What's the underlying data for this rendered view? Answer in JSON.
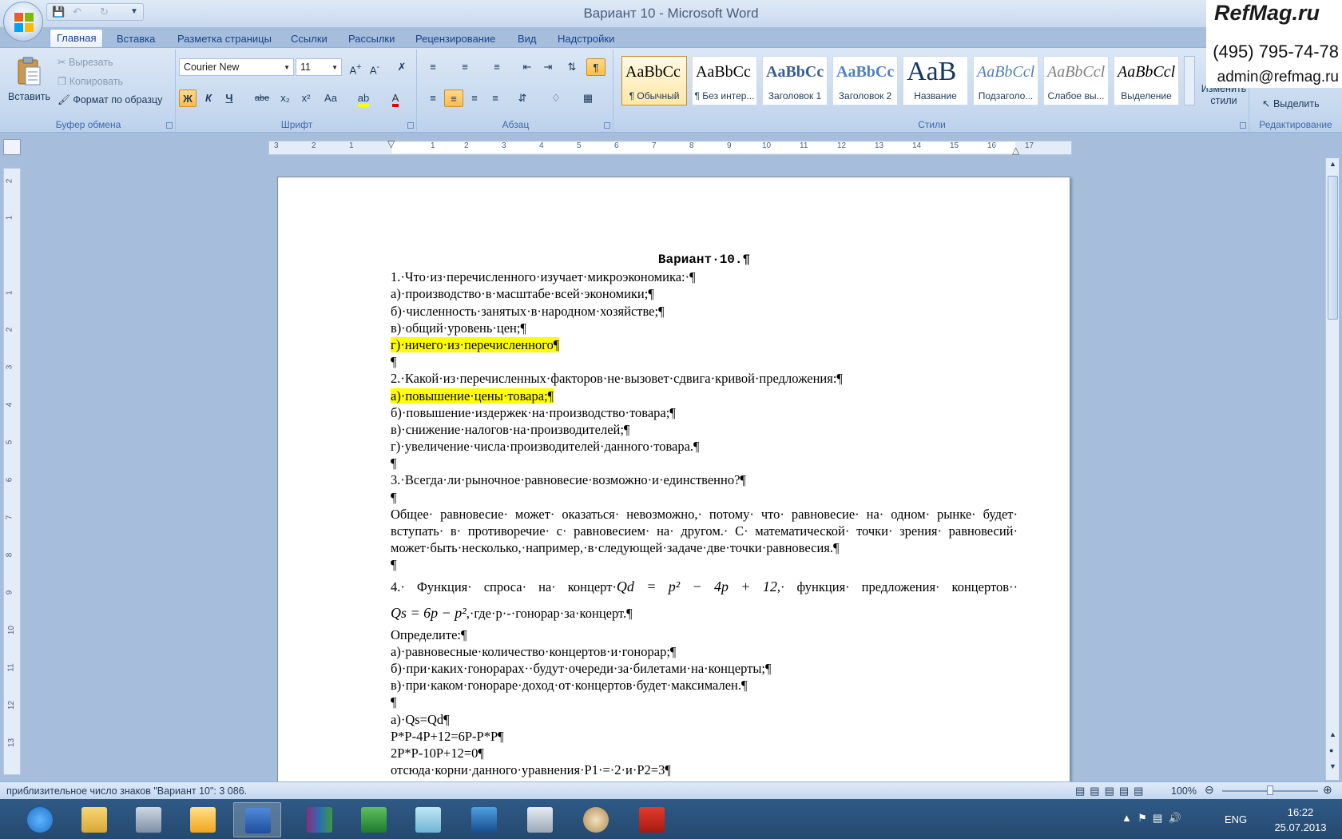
{
  "window": {
    "title": "Вариант 10 - Microsoft Word",
    "quick_access": [
      "save",
      "undo",
      "redo",
      "customize"
    ]
  },
  "watermark": {
    "logo": "RefMag.ru",
    "phone": "(495) 795-74-78",
    "email": "admin@refmag.ru"
  },
  "tabs": [
    {
      "label": "Главная",
      "active": true
    },
    {
      "label": "Вставка"
    },
    {
      "label": "Разметка страницы"
    },
    {
      "label": "Ссылки"
    },
    {
      "label": "Рассылки"
    },
    {
      "label": "Рецензирование"
    },
    {
      "label": "Вид"
    },
    {
      "label": "Надстройки"
    }
  ],
  "clipboard": {
    "label": "Буфер обмена",
    "paste": "Вставить",
    "cut": "Вырезать",
    "copy": "Копировать",
    "format_painter": "Формат по образцу"
  },
  "font": {
    "label": "Шрифт",
    "name": "Courier New",
    "size": "11",
    "buttons": [
      "Ж",
      "К",
      "Ч",
      "abe",
      "x₂",
      "x²",
      "Aa"
    ]
  },
  "paragraph": {
    "label": "Абзац"
  },
  "styles": {
    "label": "Стили",
    "items": [
      {
        "sample": "AaBbCc",
        "name": "¶ Обычный",
        "active": true
      },
      {
        "sample": "AaBbCc",
        "name": "¶ Без интер..."
      },
      {
        "sample": "AaBbCc",
        "name": "Заголовок 1"
      },
      {
        "sample": "AaBbCc",
        "name": "Заголовок 2"
      },
      {
        "sample": "AaB",
        "name": "Название"
      },
      {
        "sample": "AaBbCcl",
        "name": "Подзаголо..."
      },
      {
        "sample": "AaBbCcl",
        "name": "Слабое вы..."
      },
      {
        "sample": "AaBbCcl",
        "name": "Выделение"
      }
    ],
    "change_styles": "Изменить стили"
  },
  "editing": {
    "label": "Редактирование",
    "select": "Выделить"
  },
  "ruler_ticks": [
    "3",
    "2",
    "1",
    "1",
    "2",
    "3",
    "4",
    "5",
    "6",
    "7",
    "8",
    "9",
    "10",
    "11",
    "12",
    "13",
    "14",
    "15",
    "16",
    "17"
  ],
  "vruler_ticks": [
    "2",
    "1",
    "1",
    "2",
    "3",
    "4",
    "5",
    "6",
    "7",
    "8",
    "9",
    "10",
    "11",
    "12",
    "13"
  ],
  "document": {
    "title": "Вариант·10.¶",
    "lines": [
      {
        "text": "1.·Что·из·перечисленного·изучает·микроэкономика:·¶"
      },
      {
        "text": "а)·производство·в·масштабе·всей·экономики;¶"
      },
      {
        "text": "б)·численность·занятых·в·народном·хозяйстве;¶"
      },
      {
        "text": "в)·общий·уровень·цен;¶"
      },
      {
        "text": "г)·ничего·из·перечисленного¶",
        "hl": true
      },
      {
        "text": "¶"
      },
      {
        "text": "2.·Какой·из·перечисленных·факторов·не·вызовет·сдвига·кривой·предложения:¶"
      },
      {
        "text": "а)·повышение·цены·товара;¶",
        "hl": true
      },
      {
        "text": "б)·повышение·издержек·на·производство·товара;¶"
      },
      {
        "text": "в)·снижение·налогов·на·производителей;¶"
      },
      {
        "text": "г)·увеличение·числа·производителей·данного·товара.¶"
      },
      {
        "text": "¶"
      },
      {
        "text": "3.·Всегда·ли·рыночное·равновесие·возможно·и·единственно?¶"
      },
      {
        "text": "¶"
      },
      {
        "text": "Общее· равновесие· может· оказаться· невозможно,· потому· что· равновесие· на· одном· рынке· будет·",
        "justify": true
      },
      {
        "text": "вступать· в· противоречие· с· равновесием· на· другом.· С· математической· точки· зрения· равновесий·",
        "justify": true
      },
      {
        "text": "может·быть·несколько,·например,·в·следующей·задаче·две·точки·равновесия.¶"
      },
      {
        "text": "¶"
      }
    ],
    "q4_line1_start": "4.·  Функция·  спроса·  на·  концерт·",
    "q4_formula1": "Qd = p² − 4p + 12",
    "q4_line1_end": ",·  функция·  предложения·  концертов··",
    "q4_formula2": "Qs = 6p − p²",
    "q4_line2_end": ",·где·p·-·гонорар·за·концерт.¶",
    "lines2": [
      {
        "text": "Определите:¶"
      },
      {
        "text": "а)·равновесные·количество·концертов·и·гонорар;¶"
      },
      {
        "text": "б)·при·каких·гонорарах··будут·очереди·за·билетами·на·концерты;¶"
      },
      {
        "text": "в)·при·каком·гонораре·доход·от·концертов·будет·максимален.¶"
      },
      {
        "text": "¶"
      },
      {
        "text": "а)·Qs=Qd¶"
      },
      {
        "text": "P*P-4P+12=6P-P*P¶"
      },
      {
        "text": "2P*P-10P+12=0¶"
      },
      {
        "text": "отсюда·корни·данного·уравнения·P1·=·2·и·P2=3¶"
      }
    ]
  },
  "status": {
    "text": "приблизительное число знаков \"Вариант 10\": 3 086.",
    "zoom": "100%"
  },
  "taskbar": {
    "lang": "ENG",
    "time": "16:22",
    "date": "25.07.2013"
  }
}
